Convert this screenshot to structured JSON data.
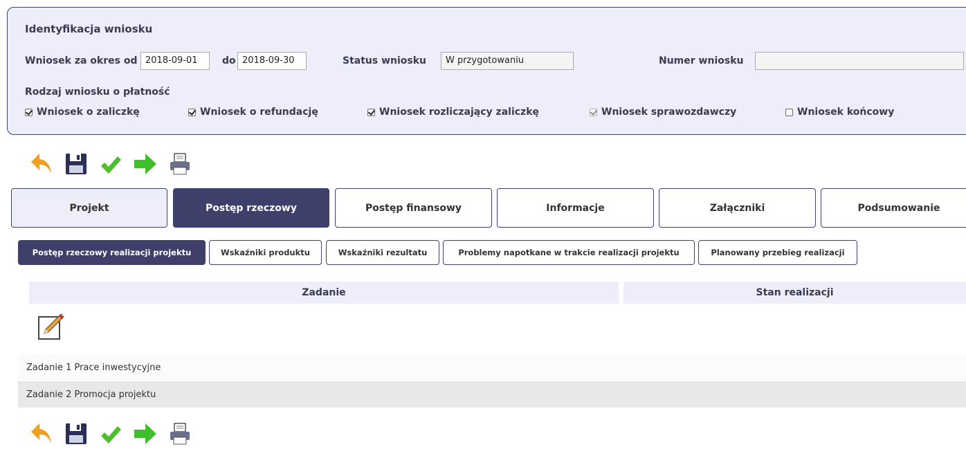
{
  "identification": {
    "title": "Identyfikacja wniosku",
    "period_from_label": "Wniosek za okres od",
    "period_from_value": "2018-09-01",
    "period_to_label": "do",
    "period_to_value": "2018-09-30",
    "status_label": "Status wniosku",
    "status_value": "W przygotowaniu",
    "number_label": "Numer wniosku",
    "number_value": "",
    "type_label": "Rodzaj wniosku o płatność",
    "types": [
      {
        "label": "Wniosek o zaliczkę",
        "checked": true,
        "enabled": true
      },
      {
        "label": "Wniosek o refundację",
        "checked": true,
        "enabled": true
      },
      {
        "label": "Wniosek rozliczający zaliczkę",
        "checked": true,
        "enabled": true
      },
      {
        "label": "Wniosek sprawozdawczy",
        "checked": true,
        "enabled": false
      },
      {
        "label": "Wniosek końcowy",
        "checked": false,
        "enabled": true
      }
    ]
  },
  "toolbar_icons": [
    "back-icon",
    "save-icon",
    "validate-icon",
    "submit-icon",
    "print-icon"
  ],
  "main_tabs": [
    {
      "label": "Projekt",
      "active": false
    },
    {
      "label": "Postęp rzeczowy",
      "active": true
    },
    {
      "label": "Postęp finansowy",
      "active": false
    },
    {
      "label": "Informacje",
      "active": false
    },
    {
      "label": "Załączniki",
      "active": false
    },
    {
      "label": "Podsumowanie",
      "active": false
    }
  ],
  "sub_tabs": [
    {
      "label": "Postęp rzeczowy realizacji projektu",
      "active": true
    },
    {
      "label": "Wskaźniki produktu",
      "active": false
    },
    {
      "label": "Wskaźniki rezultatu",
      "active": false
    },
    {
      "label": "Problemy napotkane w trakcie realizacji projektu",
      "active": false
    },
    {
      "label": "Planowany przebieg realizacji",
      "active": false
    }
  ],
  "table": {
    "columns": [
      "Zadanie",
      "Stan realizacji"
    ],
    "edit_icon": "edit-icon",
    "rows": [
      {
        "task": "Zadanie 1 Prace inwestycyjne"
      },
      {
        "task": "Zadanie 2 Promocja projektu"
      }
    ]
  },
  "colors": {
    "accent": "#3e3f6a",
    "panel_bg": "#eeeefa",
    "back": "#f0a020",
    "validate": "#4cbf2a",
    "submit": "#3fbf2a"
  }
}
